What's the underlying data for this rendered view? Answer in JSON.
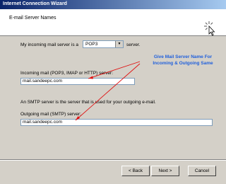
{
  "window": {
    "title": "Internet Connection Wizard"
  },
  "header": {
    "title": "E-mail Server Names"
  },
  "incoming_type": {
    "label_before": "My incoming mail server is a",
    "selected": "POP3",
    "label_after": "server."
  },
  "incoming": {
    "label": "Incoming mail (POP3, IMAP or HTTP) server:",
    "value": "mail.sandeepc.com"
  },
  "smtp_note": "An SMTP server is the server that is used for your outgoing e-mail.",
  "outgoing": {
    "label": "Outgoing mail (SMTP) server:",
    "value": "mail.sandeepc.com"
  },
  "annotation": {
    "line1": "Give Mail Server Name For",
    "line2": "Incoming & Outgoing Same",
    "color": "#1f5fdc",
    "arrow_color": "#e01010"
  },
  "buttons": {
    "back": "< Back",
    "next": "Next >",
    "cancel": "Cancel"
  }
}
